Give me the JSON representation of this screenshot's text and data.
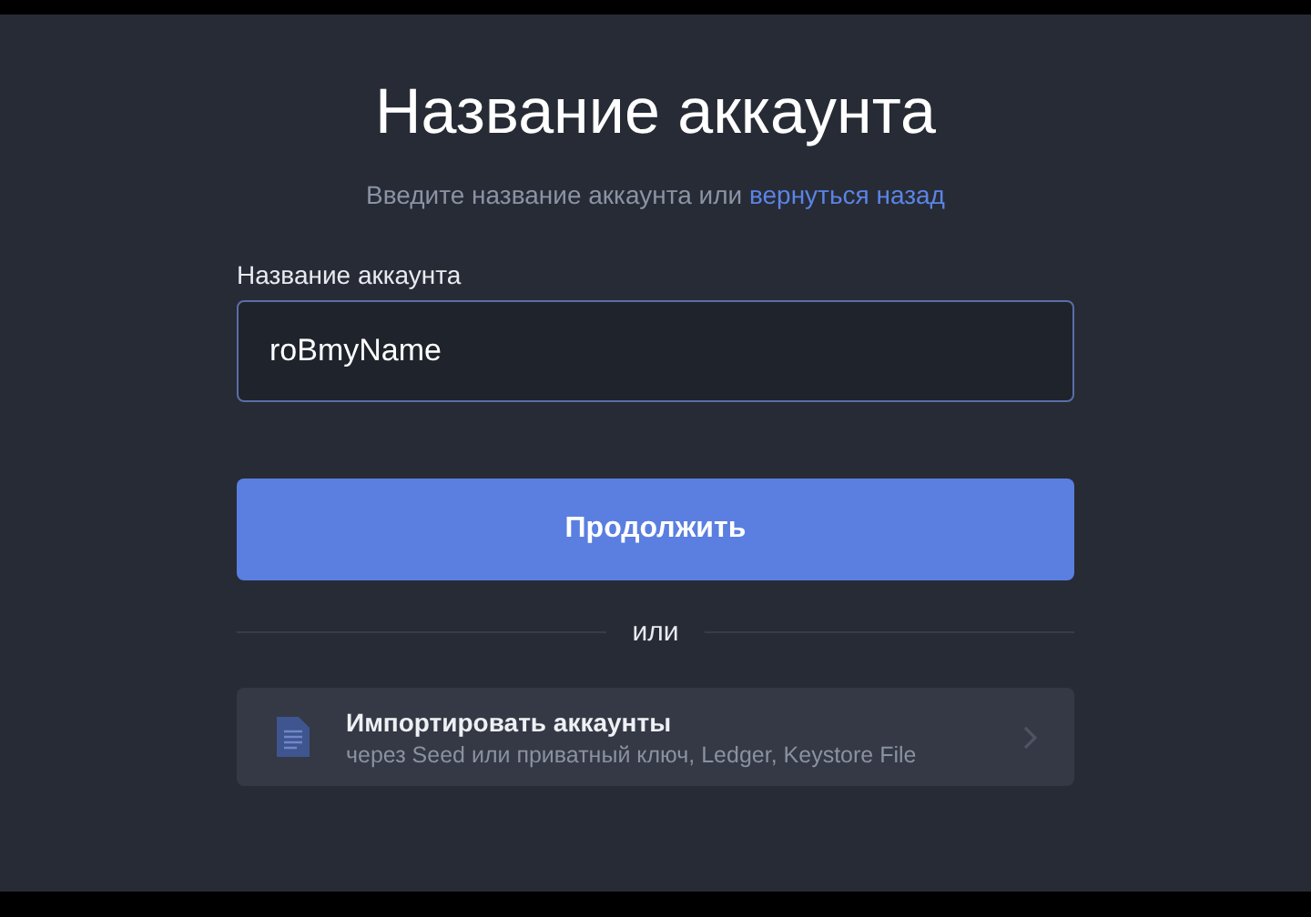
{
  "title": "Название аккаунта",
  "subtitle": {
    "text": "Введите название аккаунта или",
    "link": "вернуться назад"
  },
  "field": {
    "label": "Название аккаунта",
    "value": "roBmyName"
  },
  "continue_button": "Продолжить",
  "divider": "или",
  "import_option": {
    "title": "Импортировать аккаунты",
    "description": "через Seed или приватный ключ, Ledger, Keystore File"
  }
}
